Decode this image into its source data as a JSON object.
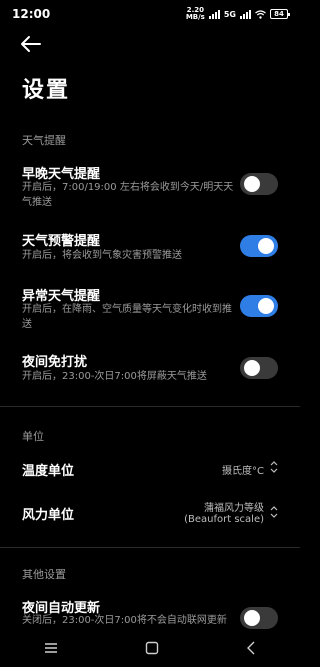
{
  "status_bar": {
    "time": "12:00",
    "speed_value": "2.20",
    "speed_unit": "MB/s",
    "network": "5G",
    "battery": "84"
  },
  "page": {
    "title": "设置"
  },
  "sections": {
    "weather_alerts": {
      "header": "天气提醒",
      "items": [
        {
          "title": "早晚天气提醒",
          "desc": "开启后，7:00/19:00 左右将会收到今天/明天天气推送",
          "enabled": false
        },
        {
          "title": "天气预警提醒",
          "desc": "开启后，将会收到气象灾害预警推送",
          "enabled": true
        },
        {
          "title": "异常天气提醒",
          "desc": "开启后，在降雨、空气质量等天气变化时收到推送",
          "enabled": true
        },
        {
          "title": "夜间免打扰",
          "desc": "开启后，23:00-次日7:00将屏蔽天气推送",
          "enabled": false
        }
      ]
    },
    "units": {
      "header": "单位",
      "temperature": {
        "label": "温度单位",
        "value": "摄氏度°C"
      },
      "wind": {
        "label": "风力单位",
        "value_line1": "蒲福风力等级",
        "value_line2": "(Beaufort scale)"
      }
    },
    "other": {
      "header": "其他设置",
      "items": [
        {
          "title": "夜间自动更新",
          "desc": "关闭后，23:00-次日7:00将不会自动联网更新",
          "enabled": false
        }
      ]
    }
  },
  "colors": {
    "accent": "#2f7ee6",
    "background": "#000000",
    "secondary_text": "#9a9a9a"
  },
  "nav": {
    "icons": [
      "menu-icon",
      "home-icon",
      "back-icon"
    ]
  }
}
